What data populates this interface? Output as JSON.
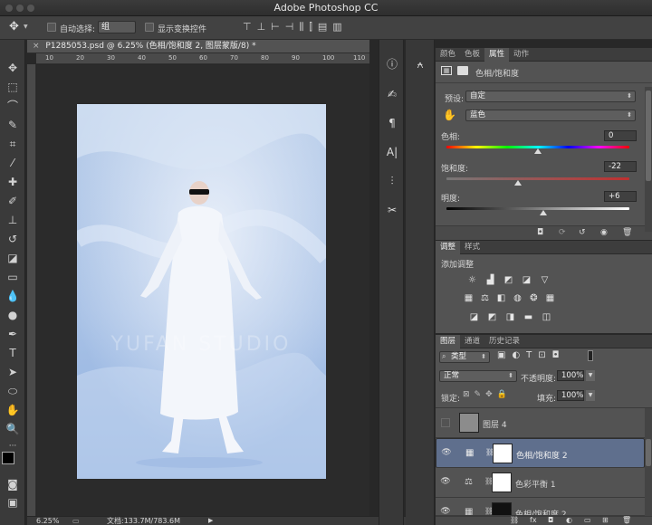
{
  "window": {
    "title": "Adobe Photoshop CC"
  },
  "options": {
    "auto_select_label": "自动选择:",
    "auto_select_value": "组",
    "transform_label": "显示变换控件"
  },
  "document": {
    "tab_title": "P1285053.psd @ 6.25% (色相/饱和度 2, 图层蒙版/8) *",
    "watermark": "YUFAN STUDIO",
    "ruler_marks": [
      "10",
      "20",
      "30",
      "40",
      "50",
      "60",
      "70",
      "80",
      "90",
      "100",
      "110"
    ]
  },
  "status": {
    "zoom": "6.25%",
    "doc_size": "文档:133.7M/783.6M"
  },
  "properties": {
    "tabs": [
      "颜色",
      "色板",
      "属性",
      "动作"
    ],
    "active_tab": 2,
    "heading": "色相/饱和度",
    "preset_label": "预设:",
    "preset_value": "自定",
    "channel_value": "蓝色",
    "hue_label": "色相:",
    "hue_value": "0",
    "hue_level": 0.5,
    "sat_label": "饱和度:",
    "sat_value": "-22",
    "sat_level": 0.39,
    "light_label": "明度:",
    "light_value": "+6",
    "light_level": 0.53
  },
  "adjustments": {
    "tabs": [
      "调整",
      "样式"
    ],
    "active_tab": 0,
    "heading": "添加调整"
  },
  "layers": {
    "tabs": [
      "图层",
      "通道",
      "历史记录"
    ],
    "active_tab": 0,
    "filter_value": "类型",
    "blend_mode": "正常",
    "opacity_label": "不透明度:",
    "opacity_value": "100%",
    "lock_label": "锁定:",
    "fill_label": "填充:",
    "fill_value": "100%",
    "items": [
      {
        "name": "图层 4",
        "visible": false,
        "selected": false
      },
      {
        "name": "色相/饱和度 2",
        "visible": true,
        "selected": true
      },
      {
        "name": "色彩平衡 1",
        "visible": true,
        "selected": false
      },
      {
        "name": "色相/饱和度 2",
        "visible": true,
        "selected": false
      }
    ]
  },
  "colors": {
    "accent_selected": "#5f6f8d",
    "foreground": "#000000",
    "background": "#ffffff"
  }
}
